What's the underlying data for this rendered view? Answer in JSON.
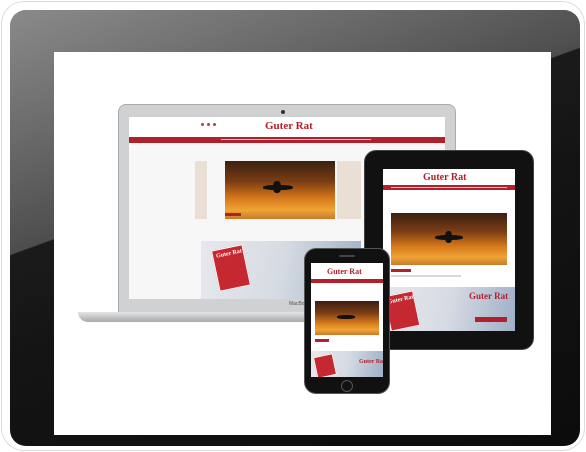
{
  "brand": {
    "logo_text": "Guter Rat",
    "accent_color": "#b3202c"
  },
  "devices": {
    "laptop_model_label": "MacBook Air"
  }
}
